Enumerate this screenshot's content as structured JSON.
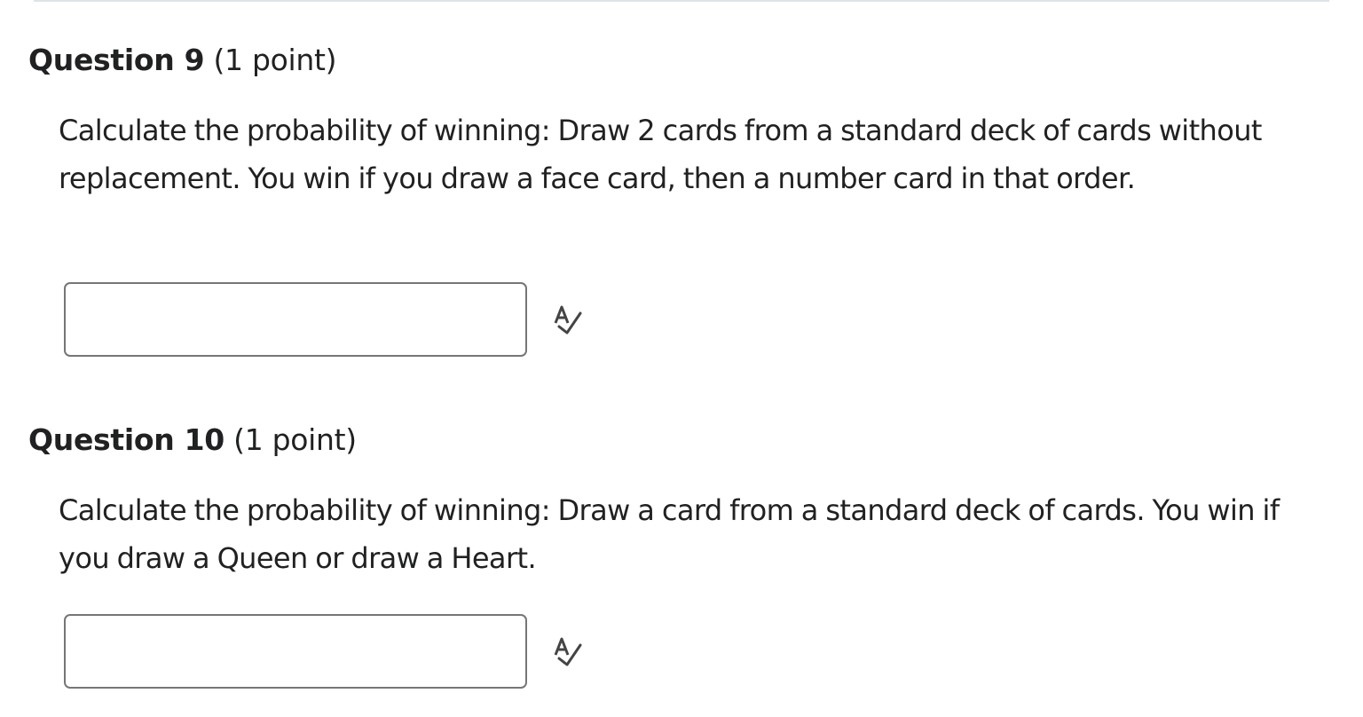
{
  "questions": [
    {
      "title": "Question 9",
      "points": "(1 point)",
      "text": "Calculate the probability of winning: Draw 2 cards from a standard deck of cards without replacement. You win if you draw a face card, then a number card in that order.",
      "answer_value": "",
      "icon": "spell-check-icon"
    },
    {
      "title": "Question 10",
      "points": "(1 point)",
      "text": "Calculate the probability of winning: Draw a card from a standard deck of cards. You win if you draw a Queen or draw a Heart.",
      "answer_value": "",
      "icon": "spell-check-icon"
    }
  ]
}
